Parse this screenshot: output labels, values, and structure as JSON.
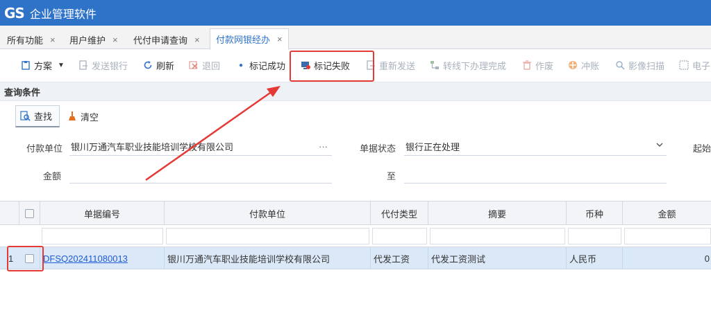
{
  "app": {
    "logo": "GS",
    "title": "企业管理软件"
  },
  "tabs": [
    {
      "label": "所有功能",
      "close": "×"
    },
    {
      "label": "用户维护",
      "close": "×"
    },
    {
      "label": "代付申请查询",
      "close": "×"
    },
    {
      "label": "付款网银经办",
      "close": "×"
    }
  ],
  "toolbar": {
    "plan": "方案",
    "send_bank": "发送银行",
    "refresh": "刷新",
    "return": "退回",
    "mark_success": "标记成功",
    "mark_fail": "标记失败",
    "resend": "重新发送",
    "offline_done": "转线下办理完成",
    "void": "作废",
    "reverse": "冲账",
    "scan": "影像扫描",
    "electronic": "电子"
  },
  "query": {
    "section_title": "查询条件",
    "find": "查找",
    "clear": "清空",
    "payer_label": "付款单位",
    "payer_value": "银川万通汽车职业技能培训学校有限公司",
    "payer_more": "···",
    "status_label": "单据状态",
    "status_value": "银行正在处理",
    "start_label": "起始",
    "amount_label": "金额",
    "to_label": "至"
  },
  "grid": {
    "columns": [
      "单据编号",
      "付款单位",
      "代付类型",
      "摘要",
      "币种",
      "金额"
    ],
    "rows": [
      {
        "index": "1",
        "doc_no": "DFSQ202411080013",
        "payer": "银川万通汽车职业技能培训学校有限公司",
        "pay_type": "代发工资",
        "summary": "代发工资测试",
        "currency": "人民币",
        "amount": "0"
      }
    ]
  },
  "colors": {
    "brand": "#2f73c9",
    "highlight": "#e53935",
    "row_selected": "#dbe8f7"
  }
}
